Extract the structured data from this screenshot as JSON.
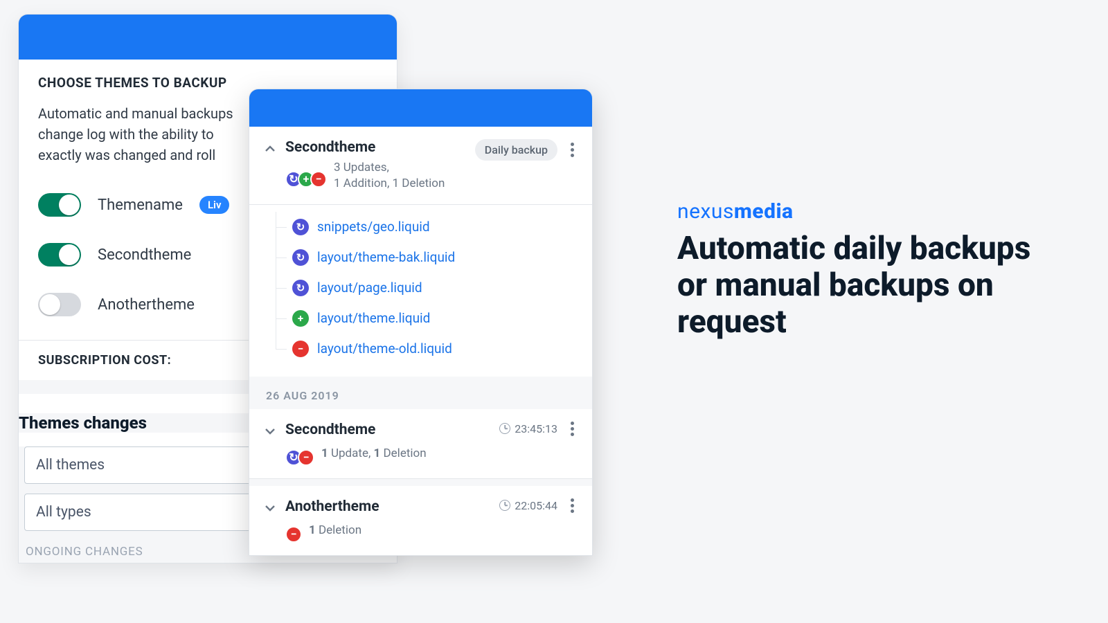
{
  "brand": {
    "part1": "nexus",
    "part2": "media"
  },
  "tagline": "Automatic daily backups or manual backups on request",
  "leftPanel": {
    "title": "CHOOSE THEMES TO BACKUP",
    "desc_l1": "Automatic and manual backups",
    "desc_l2": "change log  with the ability to",
    "desc_l3": "exactly was changed and roll",
    "themes": [
      {
        "name": "Themename",
        "on": true,
        "live": "Liv"
      },
      {
        "name": "Secondtheme",
        "on": true
      },
      {
        "name": "Anothertheme",
        "on": false
      }
    ],
    "subscription": "SUBSCRIPTION COST:",
    "changesHeading": "Themes changes",
    "filter1": "All themes",
    "filter2": "All types",
    "ongoing": "ONGOING CHANGES"
  },
  "front": {
    "entry0": {
      "name": "Secondtheme",
      "sum_l1": "3 Updates,",
      "sum_l2": "1 Addition, 1 Deletion",
      "badge": "Daily backup",
      "files": [
        {
          "t": "upd",
          "path": "snippets/geo.liquid"
        },
        {
          "t": "upd",
          "path": "layout/theme-bak.liquid"
        },
        {
          "t": "upd",
          "path": "layout/page.liquid"
        },
        {
          "t": "add",
          "path": "layout/theme.liquid"
        },
        {
          "t": "del",
          "path": "layout/theme-old.liquid"
        }
      ]
    },
    "date": "26 AUG 2019",
    "entry1": {
      "name": "Secondtheme",
      "sum_pre": "",
      "u": "1",
      "u_lbl": " Update, ",
      "d": "1",
      "d_lbl": " Deletion",
      "time": "23:45:13"
    },
    "entry2": {
      "name": "Anothertheme",
      "d": "1",
      "d_lbl": " Deletion",
      "time": "22:05:44"
    }
  }
}
